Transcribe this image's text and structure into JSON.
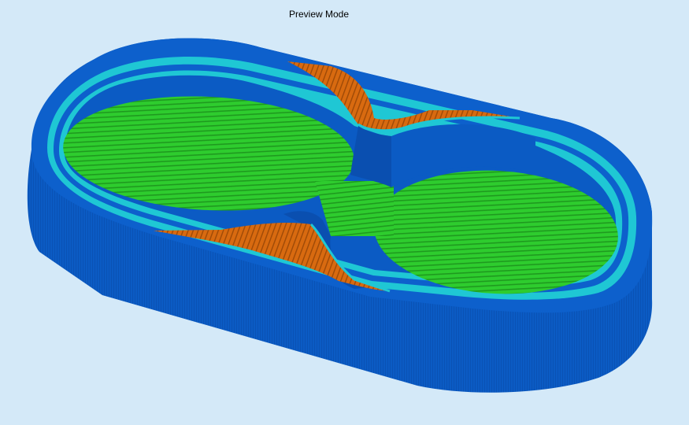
{
  "header": {
    "mode_label": "Preview Mode"
  },
  "colors": {
    "background": "#d4e9f8",
    "outer_wall": "#0b5bc4",
    "outer_wall_dark": "#0a4fb0",
    "inner_perimeter": "#1fc7d4",
    "infill": "#2ecc2e",
    "infill_lines": "#1e8f1e",
    "support": "#d86a10",
    "support_lines": "#a34c06"
  },
  "viewport": {
    "object": "3d-print-preview-double-cupholder-tray"
  }
}
